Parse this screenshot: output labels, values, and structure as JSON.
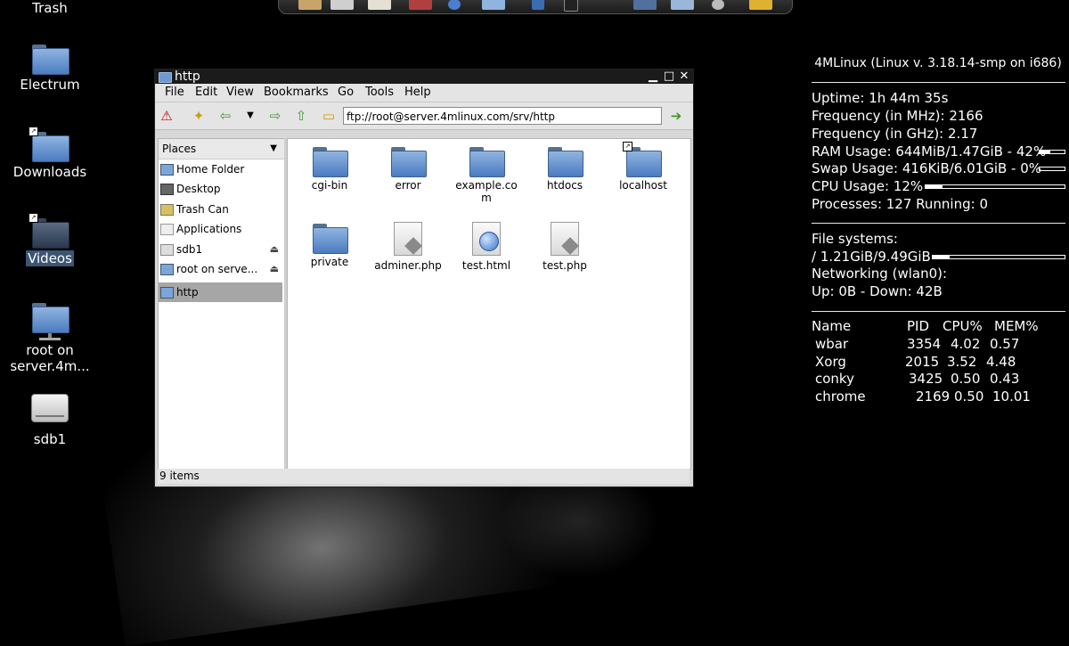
{
  "desktop": {
    "icons": [
      {
        "label": "Trash"
      },
      {
        "label": "Electrum"
      },
      {
        "label": "Downloads"
      },
      {
        "label": "Videos"
      },
      {
        "label": "root on server.4m..."
      },
      {
        "label": "sdb1"
      }
    ]
  },
  "window": {
    "title": "http",
    "menu": [
      "File",
      "Edit",
      "View",
      "Bookmarks",
      "Go",
      "Tools",
      "Help"
    ],
    "address": "ftp://root@server.4mlinux.com/srv/http",
    "sidebar_header": "Places",
    "places": [
      {
        "label": "Home Folder",
        "icon": "home-icon"
      },
      {
        "label": "Desktop",
        "icon": "desktop-icon"
      },
      {
        "label": "Trash Can",
        "icon": "trash-icon"
      },
      {
        "label": "Applications",
        "icon": "applications-icon"
      },
      {
        "label": "sdb1",
        "icon": "drive-icon"
      },
      {
        "label": "root on serve...",
        "icon": "network-icon"
      },
      {
        "label": "http",
        "icon": "folder-icon"
      }
    ],
    "files": [
      {
        "name": "cgi-bin",
        "type": "folder"
      },
      {
        "name": "error",
        "type": "folder"
      },
      {
        "name": "example.co\nm",
        "type": "folder"
      },
      {
        "name": "htdocs",
        "type": "folder"
      },
      {
        "name": "localhost",
        "type": "folder"
      },
      {
        "name": "private",
        "type": "folder"
      },
      {
        "name": "adminer.php",
        "type": "php"
      },
      {
        "name": "test.html",
        "type": "html"
      },
      {
        "name": "test.php",
        "type": "php"
      }
    ],
    "status": "9 items"
  },
  "conky": {
    "header": "4MLinux (Linux v. 3.18.14-smp on i686)",
    "uptime": "Uptime: 1h 44m 35s",
    "freq_mhz": "Frequency (in MHz): 2166",
    "freq_ghz": "Frequency (in GHz): 2.17",
    "ram": "RAM Usage: 644MiB/1.47GiB - 42%",
    "ram_pct": 42,
    "swap": "Swap Usage: 416KiB/6.01GiB - 0%",
    "swap_pct": 0,
    "cpu": "CPU Usage: 12%",
    "cpu_pct": 12,
    "processes": "Processes: 127  Running: 0",
    "fs_title": "File systems:",
    "fs_root": " / 1.21GiB/9.49GiB",
    "fs_pct": 13,
    "net_title": "Networking (wlan0):",
    "net": "Up: 0B   - Down: 42B",
    "proc_header": [
      "Name",
      "PID",
      "CPU%",
      "MEM%"
    ],
    "procs": [
      [
        "wbar",
        "3354",
        "4.02",
        "0.57"
      ],
      [
        "Xorg",
        "2015",
        "3.52",
        "4.48"
      ],
      [
        "conky",
        "3425",
        "0.50",
        "0.43"
      ],
      [
        "chrome",
        "2169",
        "0.50",
        "10.01"
      ]
    ]
  }
}
